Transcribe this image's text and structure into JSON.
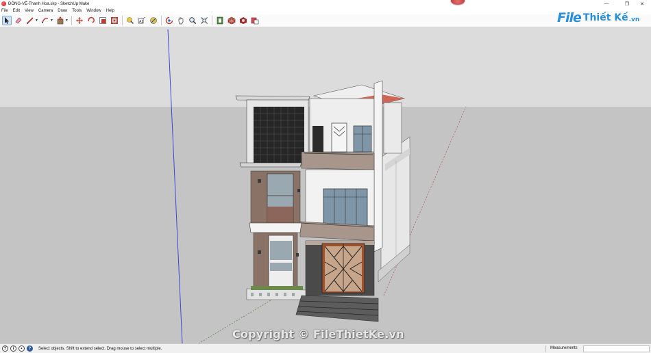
{
  "window": {
    "title": "ĐÔNG-VỆ-Thanh Hoa.skp - SketchUp Make",
    "minimize_glyph": "—",
    "restore_glyph": "❐",
    "close_glyph": "✕"
  },
  "menu": {
    "items": [
      "File",
      "Edit",
      "View",
      "Camera",
      "Draw",
      "Tools",
      "Window",
      "Help"
    ]
  },
  "toolbar": {
    "tools": [
      {
        "name": "select-tool-icon",
        "selected": true
      },
      {
        "name": "eraser-tool-icon"
      },
      {
        "name": "line-tool-icon",
        "dropdown": true
      },
      {
        "name": "shapes-tool-icon",
        "dropdown": true
      },
      {
        "name": "push-pull-tool-icon",
        "dropdown": true
      },
      {
        "name": "move-tool-icon"
      },
      {
        "name": "rotate-tool-icon"
      },
      {
        "name": "scale-tool-icon"
      },
      {
        "name": "offset-tool-icon"
      },
      {
        "name": "paint-bucket-tool-icon"
      },
      {
        "name": "tape-measure-tool-icon"
      },
      {
        "name": "text-tool-icon"
      },
      {
        "name": "dimension-tool-icon"
      },
      {
        "name": "orbit-tool-icon"
      },
      {
        "name": "pan-tool-icon"
      },
      {
        "name": "zoom-tool-icon"
      },
      {
        "name": "zoom-extents-tool-icon"
      },
      {
        "name": "section-tool-icon"
      },
      {
        "name": "3d-warehouse-icon"
      },
      {
        "name": "extension-warehouse-icon"
      },
      {
        "name": "layout-icon"
      }
    ]
  },
  "logo": {
    "file": "File",
    "rest": "Thiết Kế",
    "tld": ".vn"
  },
  "watermark": "Copyright © FileThietKe.vn",
  "status": {
    "message": "Select objects. Shift to extend select. Drag mouse to select multiple.",
    "measurements_label": "Measurements",
    "measurements_value": ""
  },
  "colors": {
    "sky": "#dcdcdc",
    "ground": "#c4c4c4",
    "wall_white": "#ececec",
    "wall_brown": "#8b7266",
    "wall_dark": "#4a4a4a",
    "glass": "#7f95a8",
    "screen": "#262626",
    "gate_wood": "#a0522d",
    "roof_red": "#c94c3a",
    "accent_blue": "#2a8fd6"
  }
}
